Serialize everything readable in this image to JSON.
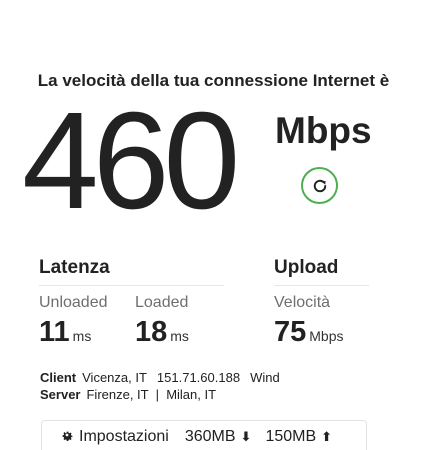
{
  "headline": "La velocità della tua connessione Internet è",
  "speed": {
    "value": "460",
    "unit": "Mbps"
  },
  "latency": {
    "title": "Latenza",
    "unloaded": {
      "label": "Unloaded",
      "value": "11",
      "unit": "ms"
    },
    "loaded": {
      "label": "Loaded",
      "value": "18",
      "unit": "ms"
    }
  },
  "upload": {
    "title": "Upload",
    "speed_label": "Velocità",
    "value": "75",
    "unit": "Mbps"
  },
  "client": {
    "label": "Client",
    "location": "Vicenza, IT",
    "ip": "151.71.60.188",
    "isp": "Wind"
  },
  "server": {
    "label": "Server",
    "locations": "Firenze, IT  |  Milan, IT"
  },
  "footer": {
    "settings_label": "Impostazioni",
    "download_amount": "360MB",
    "upload_amount": "150MB"
  },
  "icons": {
    "refresh": "refresh-icon",
    "settings": "gear-icon",
    "download": "download-arrow-icon",
    "upload": "upload-arrow-icon"
  },
  "colors": {
    "accent": "#4caf50",
    "text": "#222222",
    "muted": "#6f6f6f"
  }
}
